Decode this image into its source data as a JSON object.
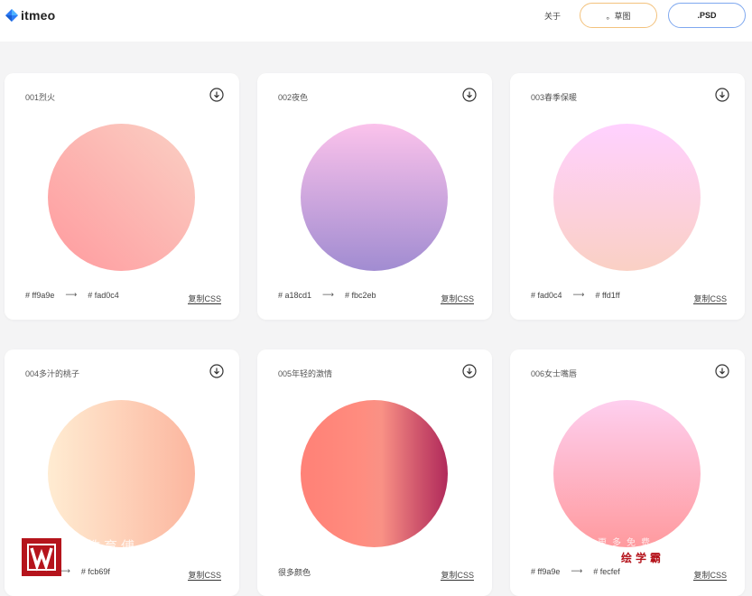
{
  "header": {
    "logo_text": "itmeo",
    "nav_about": "关于",
    "sketch_button": "。草图",
    "psd_button": ".PSD"
  },
  "cards": [
    {
      "title": "001烈火",
      "color_from": "#ff9a9e",
      "color_to": "#fad0c4",
      "from_label": "# ff9a9e",
      "to_label": "# fad0c4",
      "copy": "复制CSS"
    },
    {
      "title": "002夜色",
      "color_from": "#a18cd1",
      "color_to": "#fbc2eb",
      "from_label": "# a18cd1",
      "to_label": "# fbc2eb",
      "copy": "复制CSS"
    },
    {
      "title": "003春季保暖",
      "color_from": "#fad0c4",
      "color_to": "#ffd1ff",
      "from_label": "# fad0c4",
      "to_label": "# ffd1ff",
      "copy": "复制CSS"
    },
    {
      "title": "004多汁的桃子",
      "color_from": "#ffecd2",
      "color_to": "#fcb69f",
      "from_label": "",
      "to_label": "# fcb69f",
      "copy": "复制CSS"
    },
    {
      "title": "005年轻的激情",
      "color_from": "#ff8177",
      "color_to": "#b12a5b",
      "from_label": "很多颜色",
      "to_label": "",
      "copy": "复制CSS"
    },
    {
      "title": "006女士嘴唇",
      "color_from": "#ff9a9e",
      "color_to": "#fecfef",
      "from_label": "# ff9a9e",
      "to_label": "# fecfef",
      "copy": "复制CSS"
    }
  ],
  "watermark": {
    "left_text": "教育傅",
    "right_top": "更多免费",
    "right_bottom": "绘学霸"
  },
  "colors": {
    "sketch_border": "#f3c27d",
    "psd_border": "#7fa8ef",
    "logo_blue": "#2d7cf6",
    "watermark_red": "#b5141c"
  }
}
